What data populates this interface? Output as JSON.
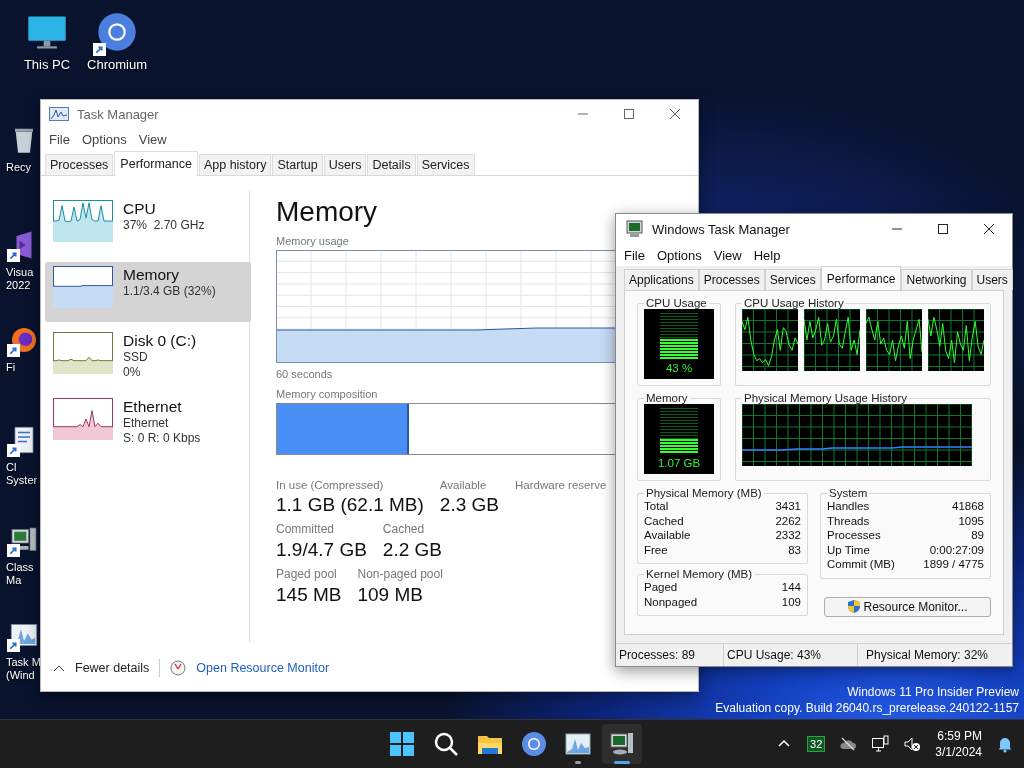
{
  "desktop_icons": [
    {
      "lines": [
        "This PC"
      ],
      "shortcut": false
    },
    {
      "lines": [
        "Chromium"
      ],
      "shortcut": true
    },
    {
      "lines": [
        "Recy"
      ],
      "shortcut": false
    },
    {
      "lines": [
        "Visua",
        "2022"
      ],
      "shortcut": true
    },
    {
      "lines": [
        "Fi"
      ],
      "shortcut": true
    },
    {
      "lines": [
        "Cl",
        "Syster"
      ],
      "shortcut": true
    },
    {
      "lines": [
        "Class",
        "Ma"
      ],
      "shortcut": true
    },
    {
      "lines": [
        "Task M",
        "(Wind"
      ],
      "shortcut": true
    }
  ],
  "task_manager": {
    "title": "Task Manager",
    "menu": [
      "File",
      "Options",
      "View"
    ],
    "tabs": [
      {
        "label": "Processes",
        "selected": false
      },
      {
        "label": "Performance",
        "selected": true
      },
      {
        "label": "App history",
        "selected": false
      },
      {
        "label": "Startup",
        "selected": false
      },
      {
        "label": "Users",
        "selected": false
      },
      {
        "label": "Details",
        "selected": false
      },
      {
        "label": "Services",
        "selected": false
      }
    ],
    "sidebar": [
      {
        "title": "CPU",
        "lines": [
          "37%  2.70 GHz"
        ],
        "selected": false
      },
      {
        "title": "Memory",
        "lines": [
          "1.1/3.4 GB (32%)"
        ],
        "selected": true
      },
      {
        "title": "Disk 0 (C:)",
        "lines": [
          "SSD",
          "0%"
        ],
        "selected": false
      },
      {
        "title": "Ethernet",
        "lines": [
          "Ethernet",
          "S: 0 R: 0 Kbps"
        ],
        "selected": false
      }
    ],
    "heading": "Memory",
    "usage_label": "Memory usage",
    "time_label": "60 seconds",
    "composition_label": "Memory composition",
    "composition": {
      "level": 0.31
    },
    "stats": [
      [
        {
          "label": "In use (Compressed)",
          "value": "1.1 GB (62.1 MB)"
        },
        {
          "label": "Available",
          "value": "2.3 GB"
        },
        {
          "label": "Hardware reserve"
        }
      ],
      [
        {
          "label": "Committed",
          "value": "1.9/4.7 GB"
        },
        {
          "label": "Cached",
          "value": "2.2 GB"
        }
      ],
      [
        {
          "label": "Paged pool",
          "value": "145 MB"
        },
        {
          "label": "Non-paged pool",
          "value": "109 MB"
        }
      ]
    ],
    "fewer_details": "Fewer details",
    "resource_link": "Open Resource Monitor"
  },
  "classic_task_manager": {
    "title": "Windows Task Manager",
    "menu": [
      "File",
      "Options",
      "View",
      "Help"
    ],
    "tabs": [
      {
        "label": "Applications",
        "selected": false
      },
      {
        "label": "Processes",
        "selected": false
      },
      {
        "label": "Services",
        "selected": false
      },
      {
        "label": "Performance",
        "selected": true
      },
      {
        "label": "Networking",
        "selected": false
      },
      {
        "label": "Users",
        "selected": false
      }
    ],
    "cpu_usage": {
      "legend": "CPU Usage",
      "reading": "43 %",
      "level": 0.43
    },
    "cpu_history": {
      "legend": "CPU Usage History"
    },
    "memory": {
      "legend": "Memory",
      "reading": "1.07 GB",
      "level": 0.32
    },
    "memory_history": {
      "legend": "Physical Memory Usage History"
    },
    "physical_memory": {
      "legend": "Physical Memory (MB)",
      "rows": [
        {
          "label": "Total",
          "value": "3431"
        },
        {
          "label": "Cached",
          "value": "2262"
        },
        {
          "label": "Available",
          "value": "2332"
        },
        {
          "label": "Free",
          "value": "83"
        }
      ]
    },
    "kernel_memory": {
      "legend": "Kernel Memory (MB)",
      "rows": [
        {
          "label": "Paged",
          "value": "144"
        },
        {
          "label": "Nonpaged",
          "value": "109"
        }
      ]
    },
    "system": {
      "legend": "System",
      "rows": [
        {
          "label": "Handles",
          "value": "41868"
        },
        {
          "label": "Threads",
          "value": "1095"
        },
        {
          "label": "Processes",
          "value": "89"
        },
        {
          "label": "Up Time",
          "value": "0:00:27:09"
        },
        {
          "label": "Commit (MB)",
          "value": "1899 / 4775"
        }
      ]
    },
    "button": "Resource Monitor...",
    "status_bar": [
      "Processes: 89",
      "CPU Usage: 43%",
      "Physical Memory: 32%"
    ]
  },
  "os_notice": [
    "Windows 11 Pro Insider Preview",
    "Evaluation copy. Build 26040.rs_prerelease.240122-1157"
  ],
  "taskbar": {
    "apps": [
      {
        "open": false,
        "selected": false
      },
      {
        "open": false,
        "selected": false
      },
      {
        "open": false,
        "selected": false
      },
      {
        "open": false,
        "selected": false
      },
      {
        "open": true,
        "selected": false
      },
      {
        "open": true,
        "selected": true
      }
    ],
    "tray_badge": "32",
    "time": "6:59 PM",
    "date": "3/1/2024"
  }
}
